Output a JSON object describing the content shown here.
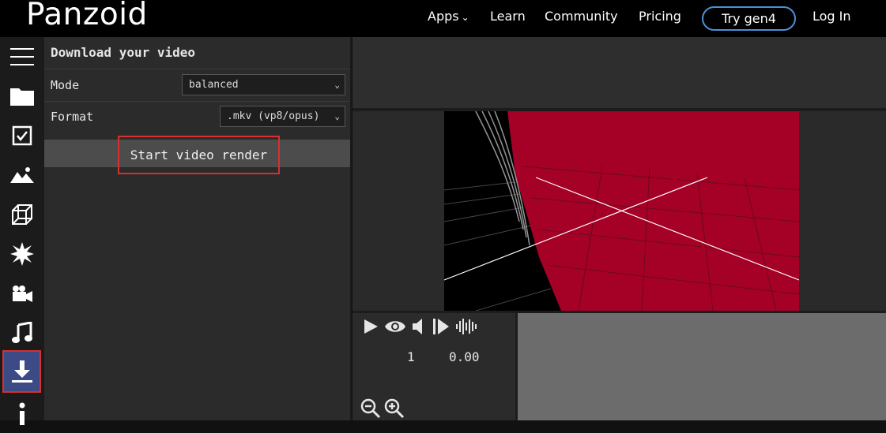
{
  "header": {
    "brand": "Panzoid",
    "nav": {
      "apps": "Apps",
      "learn": "Learn",
      "community": "Community",
      "pricing": "Pricing",
      "try": "Try gen4",
      "login": "Log In"
    }
  },
  "sidebar": {
    "items": [
      {
        "icon": "menu-icon"
      },
      {
        "icon": "folder-icon"
      },
      {
        "icon": "checkbox-icon"
      },
      {
        "icon": "image-icon"
      },
      {
        "icon": "cube-icon"
      },
      {
        "icon": "burst-icon"
      },
      {
        "icon": "camera-icon"
      },
      {
        "icon": "music-icon"
      },
      {
        "icon": "download-icon",
        "active": true
      },
      {
        "icon": "info-icon"
      }
    ]
  },
  "panel": {
    "title": "Download your video",
    "mode": {
      "label": "Mode",
      "value": "balanced"
    },
    "format": {
      "label": "Format",
      "value": ".mkv (vp8/opus)"
    },
    "render_button": "Start video render"
  },
  "playback": {
    "frame": "1",
    "time": "0.00"
  },
  "colors": {
    "accent_blue": "#4a90d9",
    "active_bg": "#3c4b86",
    "highlight_red": "#d63030",
    "scene_red": "#a50026"
  }
}
